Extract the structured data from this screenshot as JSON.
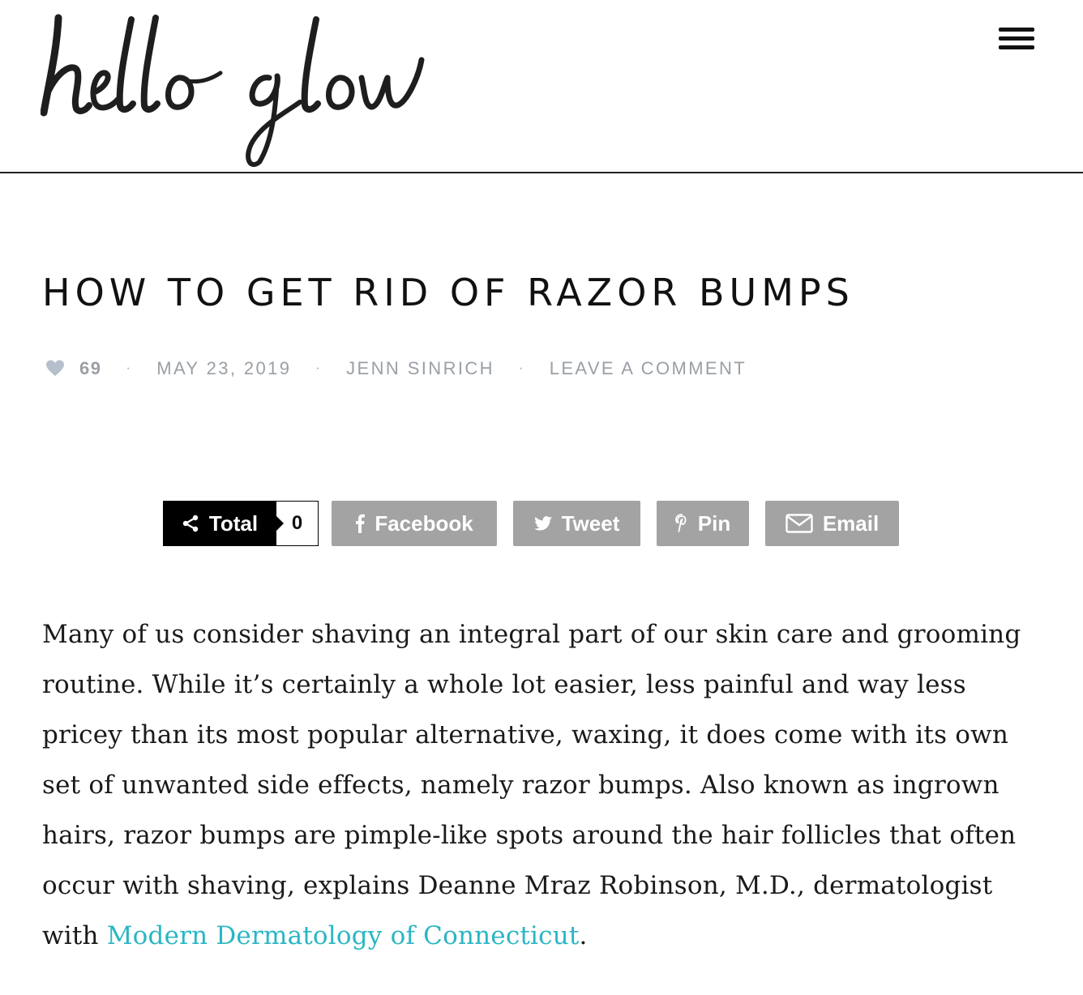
{
  "header": {
    "logo_text": "hello glow",
    "menu_icon": "hamburger-menu-icon"
  },
  "post": {
    "title": "HOW TO GET RID OF RAZOR BUMPS",
    "likes": "69",
    "date": "MAY 23, 2019",
    "author": "JENN SINRICH",
    "comment_link": "LEAVE A COMMENT",
    "separator": "·"
  },
  "share": {
    "total_label": "Total",
    "total_count": "0",
    "facebook_label": "Facebook",
    "tweet_label": "Tweet",
    "pin_label": "Pin",
    "email_label": "Email"
  },
  "article": {
    "paragraph_start": "Many of us consider shaving an integral part of our skin care and grooming routine. While it’s certainly a whole lot easier, less painful and way less pricey than its most popular alternative, waxing, it does come with its own set of unwanted side effects, namely razor bumps. Also known as ingrown hairs, razor bumps are pimple-like spots around the hair follicles that often occur with shaving, explains Deanne Mraz Robinson, M.D., dermatologist with ",
    "link_text": "Modern Dermatology of Connecticut",
    "paragraph_end": "."
  },
  "colors": {
    "meta_gray": "#9aa0a6",
    "share_gray": "#a3a3a3",
    "link_teal": "#2ab6c3",
    "text": "#1a1a1a"
  }
}
